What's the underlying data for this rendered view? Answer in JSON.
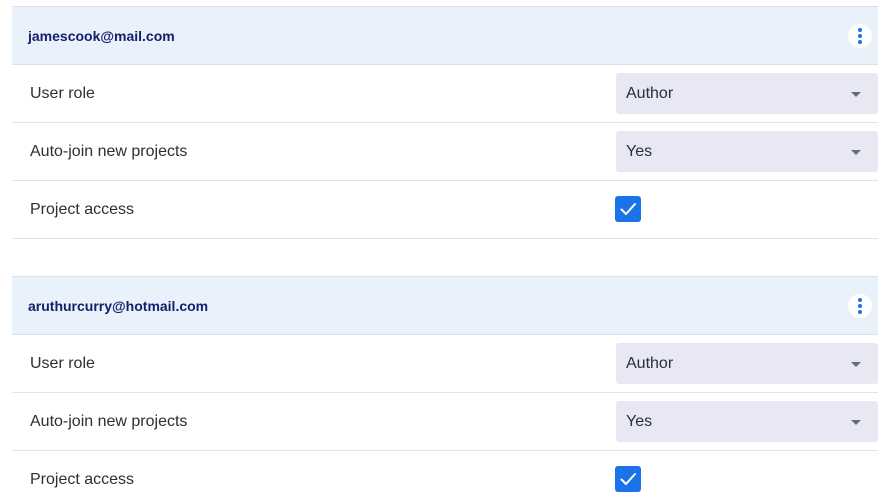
{
  "users": [
    {
      "email": "jamescook@mail.com",
      "settings": {
        "role_label": "User role",
        "role_value": "Author",
        "autojoin_label": "Auto-join new projects",
        "autojoin_value": "Yes",
        "access_label": "Project access",
        "access_checked": true
      }
    },
    {
      "email": "aruthurcurry@hotmail.com",
      "settings": {
        "role_label": "User role",
        "role_value": "Author",
        "autojoin_label": "Auto-join new projects",
        "autojoin_value": "Yes",
        "access_label": "Project access",
        "access_checked": true
      }
    }
  ],
  "icons": {
    "menu": "more-vertical-icon",
    "dropdown": "caret-down-icon",
    "checkmark": "checkmark-icon"
  },
  "colors": {
    "accent": "#1a73e8",
    "header_bg": "#e9f1fb",
    "email_text": "#14206b",
    "select_bg": "#e7e8f3"
  }
}
